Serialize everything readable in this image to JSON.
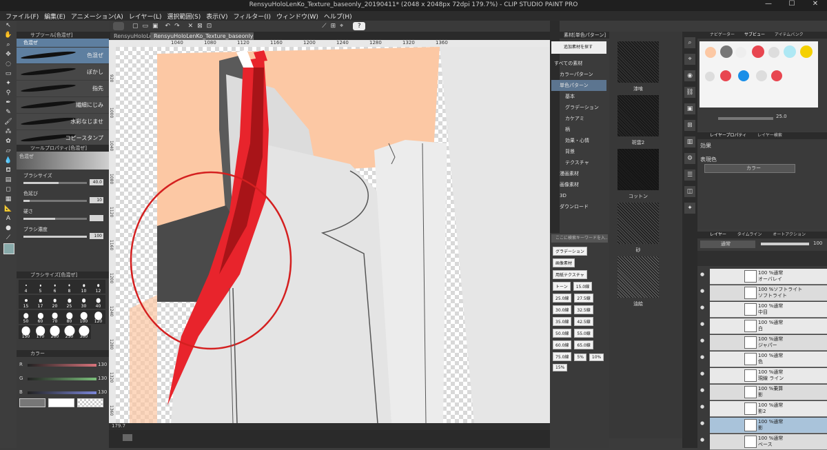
{
  "window": {
    "title": "RensyuHoloLenKo_Texture_baseonly_20190411* (2048 x 2048px 72dpi 179.7%) - CLIP STUDIO PAINT PRO",
    "min": "—",
    "max": "☐",
    "close": "✕"
  },
  "menu": [
    "ファイル(F)",
    "編集(E)",
    "アニメーション(A)",
    "レイヤー(L)",
    "選択範囲(S)",
    "表示(V)",
    "フィルター(I)",
    "ウィンドウ(W)",
    "ヘルプ(H)"
  ],
  "doc_tabs": [
    "RensyuHoloLeK...",
    "RensyuHoloLenKo_Texture_baseonly_20190411*"
  ],
  "ruler": {
    "top": [
      "1040",
      "1080",
      "1120",
      "1160",
      "1200",
      "1240",
      "1280",
      "1320",
      "1360"
    ],
    "left": [
      "920",
      "1000",
      "1040",
      "1080",
      "1120",
      "1160",
      "1200",
      "1240",
      "1280",
      "1320",
      "1360"
    ]
  },
  "sub_tool": {
    "header": "サブツール[色混ぜ]",
    "group": "色混ぜ",
    "brushes": [
      {
        "label": "色混ぜ",
        "selected": true
      },
      {
        "label": "ぼかし",
        "selected": false
      },
      {
        "label": "指先",
        "selected": false
      },
      {
        "label": "繊細にじみ",
        "selected": false
      },
      {
        "label": "水彩なじませ",
        "selected": false
      },
      {
        "label": "コピースタンプ",
        "selected": false
      }
    ]
  },
  "tool_property": {
    "header": "ツールプロパティ[色混ぜ]",
    "tool_name": "色混ぜ",
    "rows": [
      {
        "label": "ブラシサイズ",
        "value": "40.0",
        "fraction": 0.55
      },
      {
        "label": "色延び",
        "value": "10",
        "fraction": 0.1
      },
      {
        "label": "硬さ",
        "value": "",
        "fraction": 0.5
      },
      {
        "label": "ブラシ濃度",
        "value": "100",
        "fraction": 1.0
      }
    ]
  },
  "brush_size": {
    "header": "ブラシサイズ[色混ぜ]",
    "sizes": [
      "4",
      "5",
      "6",
      "8",
      "10",
      "12",
      "15",
      "17",
      "20",
      "25",
      "30",
      "40",
      "50",
      "60",
      "70",
      "80",
      "100",
      "120",
      "150",
      "170",
      "200",
      "250",
      "300"
    ]
  },
  "color_slider": {
    "header": "カラー",
    "rows": [
      {
        "label": "R",
        "value": "130",
        "color": "#d8737b"
      },
      {
        "label": "G",
        "value": "130",
        "color": "#7bbf7b"
      },
      {
        "label": "B",
        "value": "130",
        "color": "#7b86d8"
      }
    ]
  },
  "materials": {
    "header": "素材[単色パターン]",
    "add_button": "追加素材を探す",
    "tree": [
      {
        "label": "すべての素材",
        "indent": 0,
        "selected": false
      },
      {
        "label": "カラーパターン",
        "indent": 1,
        "selected": false
      },
      {
        "label": "単色パターン",
        "indent": 1,
        "selected": true
      },
      {
        "label": "基本",
        "indent": 2,
        "selected": false
      },
      {
        "label": "グラデーション",
        "indent": 2,
        "selected": false
      },
      {
        "label": "カケアミ",
        "indent": 2,
        "selected": false
      },
      {
        "label": "柄",
        "indent": 2,
        "selected": false
      },
      {
        "label": "効果・心情",
        "indent": 2,
        "selected": false
      },
      {
        "label": "背景",
        "indent": 2,
        "selected": false
      },
      {
        "label": "テクスチャ",
        "indent": 2,
        "selected": false
      },
      {
        "label": "漫画素材",
        "indent": 1,
        "selected": false
      },
      {
        "label": "画像素材",
        "indent": 1,
        "selected": false
      },
      {
        "label": "3D",
        "indent": 1,
        "selected": false
      },
      {
        "label": "ダウンロード",
        "indent": 1,
        "selected": false
      }
    ],
    "search_placeholder": "ここに検索キーワードを入...",
    "tags": [
      "グラデーション",
      "画像素材",
      "用紙テクスチャ",
      "トーン",
      "15.0線",
      "25.0線",
      "27.5線",
      "30.0線",
      "32.5線",
      "35.0線",
      "42.5線",
      "50.0線",
      "55.0線",
      "60.0線",
      "65.0線",
      "75.0線",
      "5%",
      "10%",
      "15%"
    ],
    "thumbs": [
      {
        "label": "漆喰",
        "tone": "#303030"
      },
      {
        "label": "斑雲2",
        "tone": "#262626"
      },
      {
        "label": "コットン",
        "tone": "#1c1c1c"
      },
      {
        "label": "砂",
        "tone": "#444444"
      },
      {
        "label": "油絵",
        "tone": "#555555"
      }
    ]
  },
  "sub_view": {
    "tabs": [
      "ナビゲーター",
      "サブビュー",
      "アイテムバンク"
    ],
    "zoom": "25.0"
  },
  "layer_property": {
    "tabs": [
      "レイヤープロパティ",
      "レイヤー検索"
    ],
    "effect_label": "効果",
    "expression_label": "表現色",
    "expression_value": "カラー"
  },
  "layers": {
    "tabs": [
      "レイヤー",
      "タイムライン",
      "オートアクション"
    ],
    "blend_mode": "通常",
    "opacity": "100",
    "rows": [
      {
        "line1": "100 %通常",
        "line2": "オーバレイ",
        "folder": false,
        "selected": false
      },
      {
        "line1": "100 %ソフトライト",
        "line2": "ソフトライト",
        "folder": true,
        "selected": false
      },
      {
        "line1": "100 %通常",
        "line2": "中目",
        "folder": false,
        "selected": false
      },
      {
        "line1": "100 %通常",
        "line2": "白",
        "folder": false,
        "selected": false
      },
      {
        "line1": "100 %通常",
        "line2": "ジャパー",
        "folder": true,
        "selected": false
      },
      {
        "line1": "100 %通常",
        "line2": "色",
        "folder": false,
        "selected": false
      },
      {
        "line1": "100 %通常",
        "line2": "現線 ライン",
        "folder": false,
        "selected": false
      },
      {
        "line1": "100 %乗算",
        "line2": "影",
        "folder": true,
        "selected": false
      },
      {
        "line1": "100 %通常",
        "line2": "影2",
        "folder": false,
        "selected": false
      },
      {
        "line1": "100 %通常",
        "line2": "影",
        "folder": false,
        "selected": true
      },
      {
        "line1": "100 %通常",
        "line2": "ベース",
        "folder": true,
        "selected": false
      }
    ]
  },
  "status": {
    "zoom": "179.7"
  },
  "colors": {
    "accent_select": "#5e7fa0",
    "highlight_red": "#d42020",
    "skin": "#fcc8a4"
  },
  "icons": [
    "selection-icon",
    "hand-icon",
    "zoom-icon",
    "move-icon",
    "lasso-icon",
    "eyedropper-icon",
    "pen-icon",
    "pencil-icon",
    "brush-icon",
    "airbrush-icon",
    "decoration-icon",
    "eraser-icon",
    "blend-icon",
    "fill-icon",
    "gradient-icon",
    "figure-icon",
    "frame-icon",
    "ruler-icon",
    "text-icon",
    "balloon-icon",
    "correction-icon"
  ]
}
